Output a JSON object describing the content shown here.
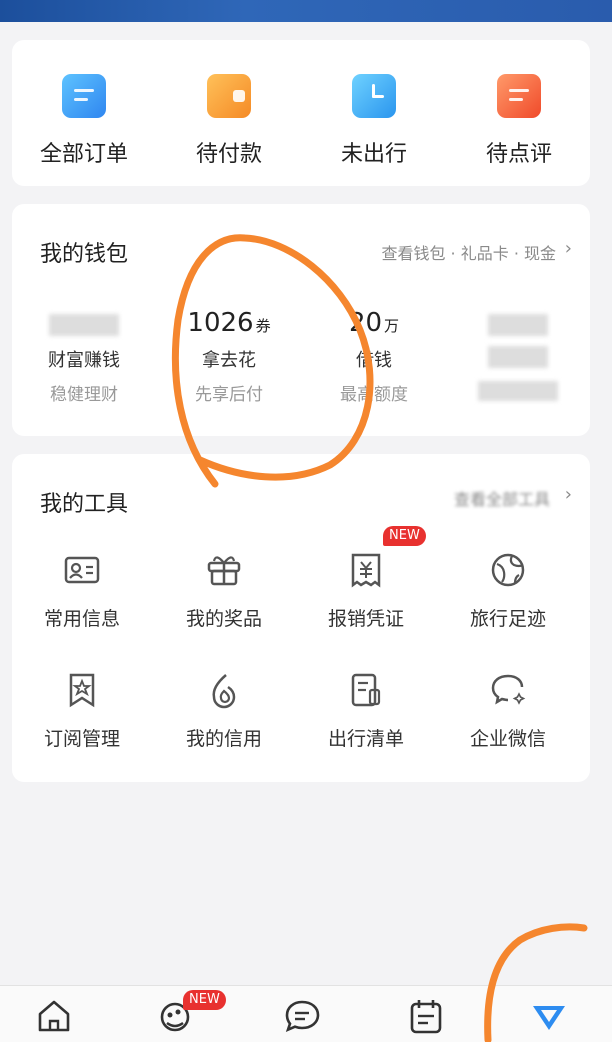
{
  "orders": [
    {
      "label": "全部订单",
      "icon": "all-orders-icon",
      "color": "#3aa0f5"
    },
    {
      "label": "待付款",
      "icon": "wallet-pay-icon",
      "color": "#f59b3a"
    },
    {
      "label": "未出行",
      "icon": "clock-icon",
      "color": "#3aa6f0"
    },
    {
      "label": "待点评",
      "icon": "review-icon",
      "color": "#f4623a"
    }
  ],
  "wallet": {
    "title": "我的钱包",
    "link": "查看钱包 · 礼品卡 · 现金",
    "items": [
      {
        "value": "",
        "unit": "",
        "name": "财富赚钱",
        "desc": "稳健理财"
      },
      {
        "value": "1026",
        "unit": "券",
        "name": "拿去花",
        "desc": "先享后付"
      },
      {
        "value": "20",
        "unit": "万",
        "name": "借钱",
        "desc": "最高额度"
      },
      {
        "value": "",
        "unit": "",
        "name": "",
        "desc": ""
      }
    ]
  },
  "tools": {
    "title": "我的工具",
    "link": "查看全部工具",
    "new_badge": "NEW",
    "items": [
      {
        "label": "常用信息",
        "icon": "id-card-icon"
      },
      {
        "label": "我的奖品",
        "icon": "gift-icon"
      },
      {
        "label": "报销凭证",
        "icon": "receipt-icon"
      },
      {
        "label": "旅行足迹",
        "icon": "globe-icon"
      },
      {
        "label": "订阅管理",
        "icon": "bookmark-star-icon"
      },
      {
        "label": "我的信用",
        "icon": "credit-drop-icon"
      },
      {
        "label": "出行清单",
        "icon": "checklist-icon"
      },
      {
        "label": "企业微信",
        "icon": "chat-bubble-icon"
      }
    ]
  },
  "nav": {
    "items": [
      "home-icon",
      "travel-icon",
      "message-icon",
      "calendar-icon",
      "my-icon"
    ],
    "new_badge": "NEW",
    "active_color": "#2d8cf0"
  },
  "annotation_color": "#f5862e"
}
